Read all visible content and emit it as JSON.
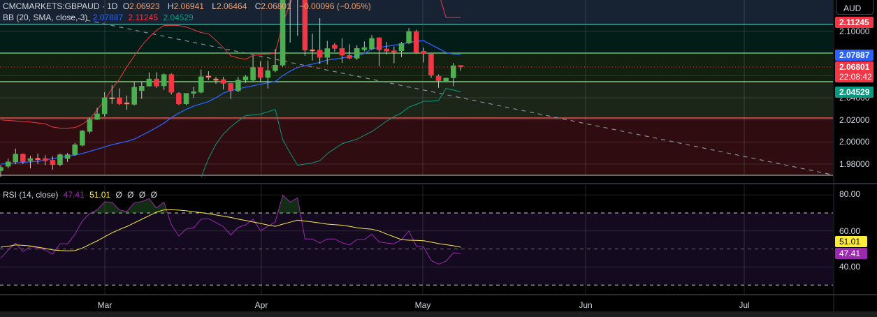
{
  "legend": {
    "symbol": "CMCMARKETS:GBPAUD · 1D",
    "open_label": "O",
    "open": "2.06923",
    "high_label": "H",
    "high": "2.06941",
    "low_label": "L",
    "low": "2.06464",
    "close_label": "C",
    "close": "2.06801",
    "change": "−0.00096 (−0.05%)",
    "bb_label": "BB (20, SMA, close, 3)",
    "bb_basis": "2.07887",
    "bb_upper": "2.11245",
    "bb_lower": "2.04529",
    "rsi_label": "RSI (14, close)",
    "rsi_value": "47.41",
    "rsi_ma": "51.01",
    "rsi_extra": [
      "Ø",
      "Ø",
      "Ø",
      "Ø"
    ]
  },
  "currency_button": "AUD",
  "price_axis": {
    "ticks": [
      "2.10000",
      "2.04000",
      "2.02000",
      "2.00000",
      "1.98000"
    ],
    "bb_upper_tag": "2.11245",
    "bb_basis_tag": "2.07887",
    "last_price_tag": "2.06801",
    "countdown": "22:08:42",
    "bb_lower_tag": "2.04529"
  },
  "rsi_axis": {
    "ticks": [
      "80.00",
      "60.00",
      "40.00"
    ],
    "ma_tag": "51.01",
    "rsi_tag": "47.41"
  },
  "date_axis": [
    "Mar",
    "Apr",
    "May",
    "Jun",
    "Jul"
  ],
  "colors": {
    "up": "#4caf50",
    "down": "#f23645",
    "doji": "#f7a77a",
    "bb_basis": "#2962ff",
    "bb_upper": "#f23645",
    "bb_lower": "#089981",
    "rsi": "#9c27b0",
    "rsi_ma": "#ffeb3b"
  },
  "chart_data": {
    "type": "candlestick",
    "title": "CMCMARKETS:GBPAUD 1D",
    "ylim": [
      1.965,
      2.128
    ],
    "levels": [
      2.1063,
      2.0804,
      2.0545,
      2.0217,
      1.9699
    ],
    "ohlc": [
      [
        1.974,
        1.979,
        1.968,
        1.977
      ],
      [
        1.978,
        1.985,
        1.976,
        1.982
      ],
      [
        1.982,
        1.994,
        1.98,
        1.989
      ],
      [
        1.989,
        1.9895,
        1.98,
        1.982
      ],
      [
        1.983,
        1.9875,
        1.976,
        1.985
      ],
      [
        1.9852,
        1.9895,
        1.98,
        1.985
      ],
      [
        1.985,
        1.988,
        1.979,
        1.983
      ],
      [
        1.9835,
        1.987,
        1.975,
        1.9795
      ],
      [
        1.9795,
        1.9895,
        1.978,
        1.9885
      ],
      [
        1.985,
        1.99,
        1.982,
        1.9885
      ],
      [
        1.9885,
        1.999,
        1.9875,
        1.9975
      ],
      [
        1.997,
        2.011,
        1.996,
        2.01
      ],
      [
        2.0095,
        2.022,
        2.0075,
        2.0205
      ],
      [
        2.0205,
        2.031,
        2.02,
        2.0255
      ],
      [
        2.0255,
        2.045,
        2.023,
        2.04
      ],
      [
        2.0402,
        2.0515,
        2.0345,
        2.04
      ],
      [
        2.04,
        2.0485,
        2.0335,
        2.0345
      ],
      [
        2.0355,
        2.042,
        2.029,
        2.0345
      ],
      [
        2.034,
        2.0547,
        2.033,
        2.0495
      ],
      [
        2.0465,
        2.0547,
        2.039,
        2.0505
      ],
      [
        2.0505,
        2.063,
        2.05,
        2.057
      ],
      [
        2.057,
        2.063,
        2.049,
        2.0505
      ],
      [
        2.0507,
        2.062,
        2.047,
        2.061
      ],
      [
        2.061,
        2.062,
        2.043,
        2.045
      ],
      [
        2.044,
        2.045,
        2.0335,
        2.0345
      ],
      [
        2.0345,
        2.044,
        2.0335,
        2.044
      ],
      [
        2.044,
        2.05,
        2.04,
        2.0455
      ],
      [
        2.045,
        2.0655,
        2.044,
        2.059
      ],
      [
        2.0595,
        2.064,
        2.056,
        2.0597
      ],
      [
        2.057,
        2.059,
        2.0525,
        2.056
      ],
      [
        2.0565,
        2.059,
        2.0475,
        2.053
      ],
      [
        2.053,
        2.0535,
        2.039,
        2.0463
      ],
      [
        2.0463,
        2.059,
        2.045,
        2.056
      ],
      [
        2.056,
        2.0605,
        2.0535,
        2.059
      ],
      [
        2.056,
        2.0779,
        2.055,
        2.0674
      ],
      [
        2.0674,
        2.073,
        2.0545,
        2.0583
      ],
      [
        2.0583,
        2.0737,
        2.0484,
        2.0645
      ],
      [
        2.0645,
        2.0842,
        2.063,
        2.0695
      ],
      [
        2.0695,
        2.135,
        2.068,
        2.132
      ],
      [
        2.133,
        2.14,
        2.09,
        2.13
      ],
      [
        2.13,
        2.142,
        2.096,
        2.134
      ],
      [
        2.138,
        2.145,
        2.078,
        2.083
      ],
      [
        2.0835,
        2.098,
        2.0737,
        2.083
      ],
      [
        2.083,
        2.112,
        2.0705,
        2.0765
      ],
      [
        2.0765,
        2.0915,
        2.07,
        2.0845
      ],
      [
        2.0878,
        2.0895,
        2.0817,
        2.0846
      ],
      [
        2.0846,
        2.0937,
        2.0716,
        2.0785
      ],
      [
        2.0783,
        2.0884,
        2.0747,
        2.0758
      ],
      [
        2.0758,
        2.0874,
        2.0743,
        2.0846
      ],
      [
        2.0835,
        2.091,
        2.082,
        2.0853
      ],
      [
        2.0842,
        2.0968,
        2.083,
        2.0937
      ],
      [
        2.0943,
        2.0947,
        2.0684,
        2.0832
      ],
      [
        2.0842,
        2.0905,
        2.079,
        2.0821
      ],
      [
        2.0825,
        2.0863,
        2.0712,
        2.0812
      ],
      [
        2.0825,
        2.0905,
        2.0768,
        2.089
      ],
      [
        2.0895,
        2.1032,
        2.0884,
        2.1
      ],
      [
        2.1,
        2.1015,
        2.08,
        2.081
      ],
      [
        2.0821,
        2.0853,
        2.072,
        2.08
      ],
      [
        2.0796,
        2.08,
        2.058,
        2.0606
      ],
      [
        2.0595,
        2.061,
        2.049,
        2.0555
      ],
      [
        2.0547,
        2.058,
        2.054,
        2.0578
      ],
      [
        2.058,
        2.0716,
        2.0505,
        2.069
      ],
      [
        2.06923,
        2.06941,
        2.06464,
        2.06801
      ]
    ],
    "bb_basis": [
      1.98,
      1.9805,
      1.981,
      1.9815,
      1.982,
      1.9825,
      1.9835,
      1.985,
      1.986,
      1.987,
      1.9882,
      1.9895,
      1.9915,
      1.9935,
      1.9955,
      1.9975,
      1.999,
      2.0005,
      2.0025,
      2.006,
      2.0094,
      2.013,
      2.017,
      2.0221,
      2.026,
      2.0295,
      2.0325,
      2.0345,
      2.0365,
      2.04,
      2.0442,
      2.0465,
      2.048,
      2.0495,
      2.0508,
      2.0522,
      2.0535,
      2.0547,
      2.06,
      2.064,
      2.0674,
      2.069,
      2.0705,
      2.072,
      2.0741,
      2.075,
      2.076,
      2.077,
      2.0779,
      2.08,
      2.0842,
      2.0855,
      2.0865,
      2.0875,
      2.0884,
      2.09,
      2.091,
      2.0916,
      2.088,
      2.0845,
      2.081,
      2.0795,
      2.07887
    ],
    "bb_upper": [
      2.02,
      2.0195,
      2.019,
      2.0185,
      2.018,
      2.0172,
      2.0165,
      2.0135,
      2.0125,
      2.0125,
      2.013,
      2.016,
      2.021,
      2.029,
      2.0379,
      2.048,
      2.0568,
      2.068,
      2.0779,
      2.087,
      2.0947,
      2.101,
      2.1053,
      2.1055,
      2.1053,
      2.104,
      2.1015,
      2.099,
      2.0979,
      2.092,
      2.0853,
      2.0779,
      2.076,
      2.0747,
      2.0783,
      2.079,
      2.0795,
      2.0804,
      2.1074,
      2.125,
      2.14,
      2.15,
      2.155,
      2.155,
      2.155,
      2.155,
      2.155,
      2.155,
      2.155,
      2.155,
      2.155,
      2.155,
      2.155,
      2.155,
      2.155,
      2.155,
      2.155,
      2.155,
      2.15,
      2.135,
      2.1126,
      2.1125,
      2.11245
    ],
    "bb_lower": [
      1.93,
      1.93,
      1.93,
      1.93,
      1.93,
      1.93,
      1.93,
      1.93,
      1.93,
      1.93,
      1.93,
      1.93,
      1.93,
      1.93,
      1.93,
      1.93,
      1.93,
      1.93,
      1.93,
      1.93,
      1.93,
      1.93,
      1.93,
      1.93,
      1.93,
      1.95,
      1.962,
      1.968,
      1.985,
      1.998,
      2.0071,
      2.0137,
      2.019,
      2.0238,
      2.0245,
      2.0252,
      2.0272,
      2.0295,
      2.0021,
      1.99,
      1.9789,
      1.98,
      1.981,
      1.9831,
      1.9894,
      1.994,
      1.9983,
      2.0005,
      2.0025,
      2.006,
      2.0094,
      2.014,
      2.0189,
      2.023,
      2.0263,
      2.0316,
      2.034,
      2.0368,
      2.0368,
      2.0375,
      2.0484,
      2.047,
      2.04529
    ],
    "rsi": [
      44.9,
      49.4,
      53.3,
      48.5,
      51.3,
      50.7,
      49.4,
      47.1,
      52.9,
      52.9,
      58.1,
      65.6,
      69.7,
      71.7,
      76.2,
      76.0,
      71.7,
      70.8,
      75.7,
      76.3,
      77.9,
      72.7,
      76.0,
      63.4,
      57.2,
      61.1,
      61.7,
      66.5,
      66.8,
      64.7,
      62.4,
      57.8,
      62.0,
      63.4,
      66.5,
      60.2,
      62.6,
      65.0,
      79.8,
      76.0,
      78.4,
      55.6,
      55.6,
      53.3,
      55.6,
      55.6,
      53.5,
      52.3,
      55.2,
      55.2,
      58.2,
      53.9,
      53.3,
      52.9,
      55.2,
      60.0,
      51.7,
      51.0,
      43.6,
      41.6,
      43.2,
      47.9,
      47.41
    ],
    "rsi_ma": [
      51,
      51.5,
      52.3,
      52,
      51.7,
      51,
      50.3,
      49.5,
      49.2,
      49,
      49.1,
      50.5,
      52.5,
      54.5,
      56.8,
      59,
      60.8,
      62.5,
      64.5,
      66.5,
      68.5,
      70.5,
      71.7,
      71.8,
      71.6,
      71.2,
      70.7,
      70.2,
      69.6,
      68.9,
      68.2,
      67.5,
      66.6,
      65.8,
      65,
      64.2,
      63.3,
      62.6,
      63.8,
      64.9,
      66,
      65.5,
      65,
      64.4,
      63.8,
      63.5,
      63.2,
      62.6,
      61.8,
      61.3,
      61,
      60,
      58.3,
      56.8,
      55.2,
      54.9,
      54.8,
      54.6,
      53.8,
      53,
      52.4,
      51.8,
      51.01
    ],
    "rsi_levels": [
      70,
      50,
      30
    ],
    "rsi_ylim": [
      25,
      85
    ]
  }
}
